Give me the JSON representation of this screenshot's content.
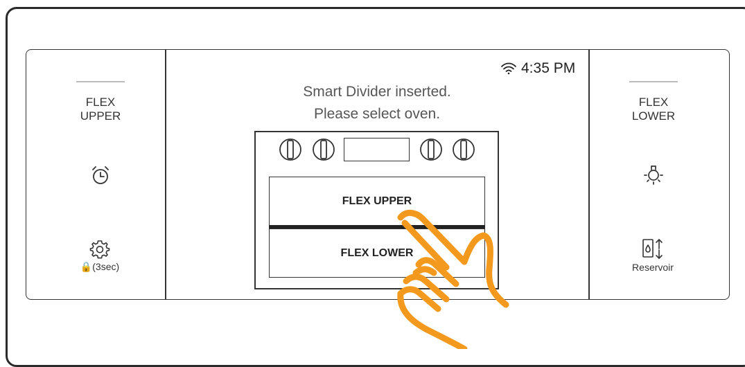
{
  "left_panel": {
    "label": "FLEX\nUPPER",
    "timer_icon": "alarm-clock-icon",
    "settings_icon": "gear-icon",
    "lock_caption": "🔒(3sec)"
  },
  "right_panel": {
    "label": "FLEX\nLOWER",
    "light_icon": "light-bulb-icon",
    "reservoir_icon": "water-reservoir-icon",
    "reservoir_caption": "Reservoir"
  },
  "status_bar": {
    "wifi_icon": "wifi-icon",
    "time": "4:35 PM"
  },
  "message": {
    "line1": "Smart Divider inserted.",
    "line2": "Please select oven."
  },
  "oven": {
    "upper_button": "FLEX UPPER",
    "lower_button": "FLEX LOWER",
    "knob_count_left": 2,
    "knob_count_right": 2
  },
  "colors": {
    "hand": "#f39a1e",
    "outline": "#333333",
    "text": "#555555"
  },
  "overlay": {
    "hand_icon": "tapping-hand-icon"
  }
}
